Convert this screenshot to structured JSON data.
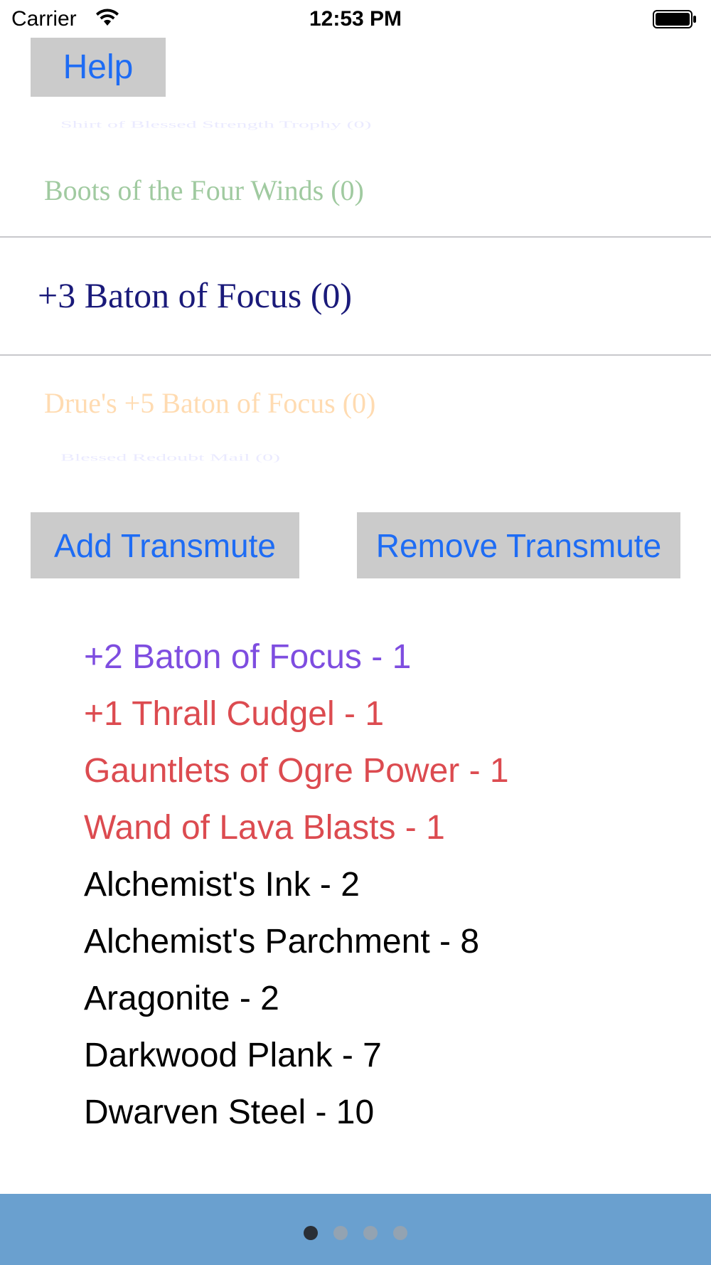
{
  "status_bar": {
    "carrier": "Carrier",
    "time": "12:53 PM"
  },
  "help_button": {
    "label": "Help"
  },
  "picker": {
    "rows": [
      "Shirt of Blessed Strength Trophy (0)",
      "Boots of the Four Winds (0)",
      "+3 Baton of Focus (0)",
      "Drue's +5 Baton of Focus (0)",
      "Blessed Redoubt Mail (0)"
    ],
    "selected_index": 2
  },
  "buttons": {
    "add_label": "Add Transmute",
    "remove_label": "Remove Transmute"
  },
  "ingredients": [
    {
      "text": "+2 Baton of Focus - 1",
      "color": "#7e4de0"
    },
    {
      "text": "+1 Thrall Cudgel - 1",
      "color": "#dc4b50"
    },
    {
      "text": "Gauntlets of Ogre Power - 1",
      "color": "#dc4b50"
    },
    {
      "text": "Wand of Lava Blasts - 1",
      "color": "#dc4b50"
    },
    {
      "text": "Alchemist's Ink - 2",
      "color": "#000000"
    },
    {
      "text": "Alchemist's Parchment - 8",
      "color": "#000000"
    },
    {
      "text": "Aragonite - 2",
      "color": "#000000"
    },
    {
      "text": "Darkwood Plank - 7",
      "color": "#000000"
    },
    {
      "text": "Dwarven Steel - 10",
      "color": "#000000"
    }
  ],
  "page_control": {
    "pages": 4,
    "current": 0
  },
  "colors": {
    "button_bg": "#cbcbcb",
    "button_text": "#1e6cf4",
    "footer_bg": "#6aa0cf"
  }
}
